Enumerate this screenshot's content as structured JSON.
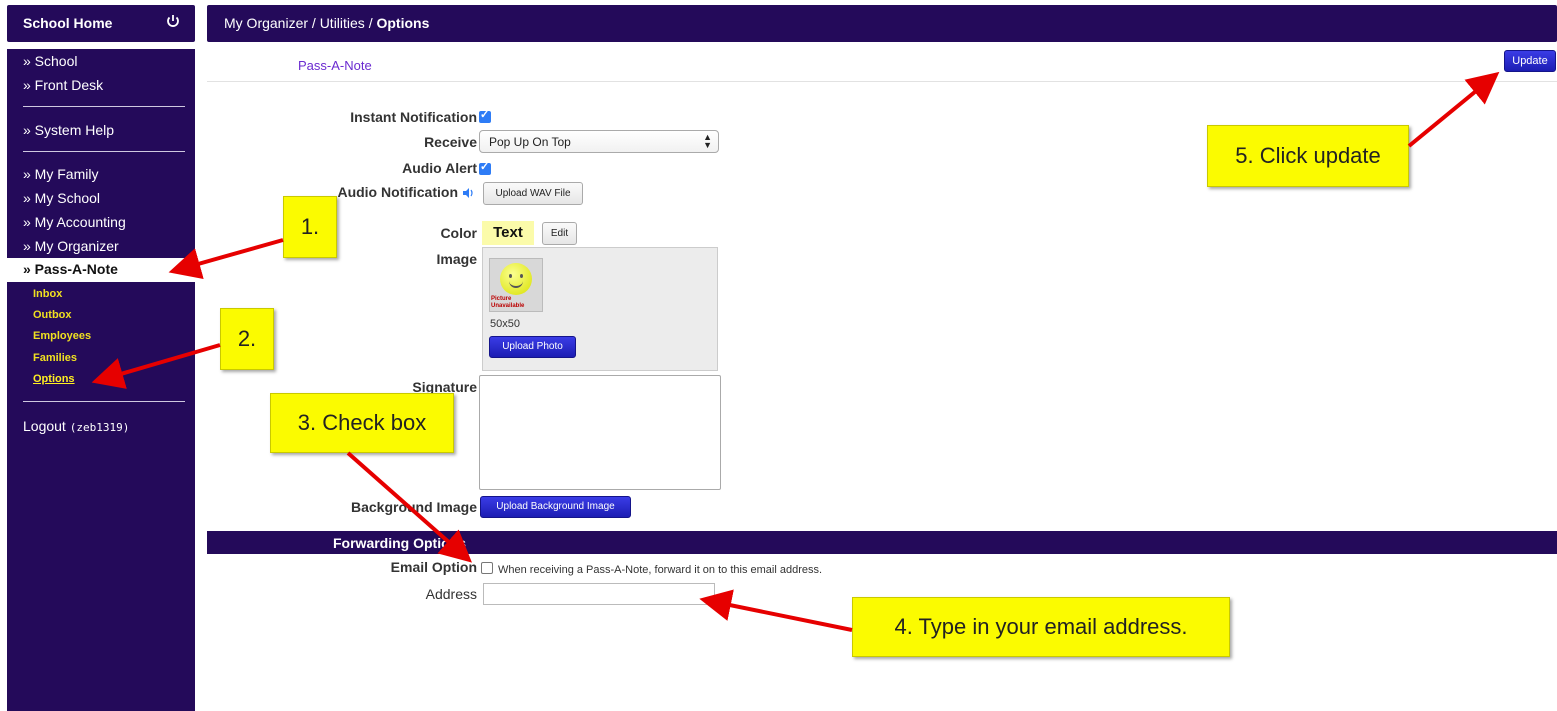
{
  "sidebar": {
    "header_title": "School Home",
    "items": [
      "» School",
      "» Front Desk",
      "» System Help",
      "» My Family",
      "» My School",
      "» My Accounting",
      "» My Organizer"
    ],
    "active_item": "» Pass-A-Note",
    "subitems": [
      "Inbox",
      "Outbox",
      "Employees",
      "Families",
      "Options"
    ],
    "logout_label": "Logout",
    "logout_user": "(zeb1319)"
  },
  "topbar": {
    "crumb_prefix": "My Organizer / Utilities / ",
    "crumb_current": "Options"
  },
  "page": {
    "subtitle": "Pass-A-Note",
    "update_label": "Update"
  },
  "form": {
    "instant_notification_label": "Instant Notification",
    "instant_notification_checked": true,
    "receive_label": "Receive",
    "receive_value": "Pop Up On Top",
    "audio_alert_label": "Audio Alert",
    "audio_alert_checked": true,
    "audio_notification_label": "Audio Notification",
    "upload_wav_label": "Upload WAV File",
    "color_label": "Color",
    "color_sample_text": "Text",
    "color_sample_bg": "#fbfbaa",
    "edit_label": "Edit",
    "image_label": "Image",
    "thumb_text": "Picture Unavailable",
    "image_size": "50x50",
    "upload_photo_label": "Upload Photo",
    "signature_label": "Signature",
    "signature_value": "",
    "background_image_label": "Background Image",
    "upload_bg_label": "Upload Background Image",
    "forwarding_title": "Forwarding Options",
    "email_option_label": "Email Option",
    "email_option_checked": false,
    "email_option_note": "When receiving a Pass-A-Note, forward it on to this email address.",
    "address_label": "Address",
    "address_value": ""
  },
  "callouts": {
    "c1": "1.",
    "c2": "2.",
    "c3": "3. Check box",
    "c4": "4. Type in your email address.",
    "c5": "5. Click update"
  },
  "colors": {
    "nav_bg": "#240a5a",
    "sub_link": "#f0e020",
    "accent_blue": "#1c1db3",
    "callout_yellow": "#fbfb00",
    "arrow_red": "#e60000"
  }
}
